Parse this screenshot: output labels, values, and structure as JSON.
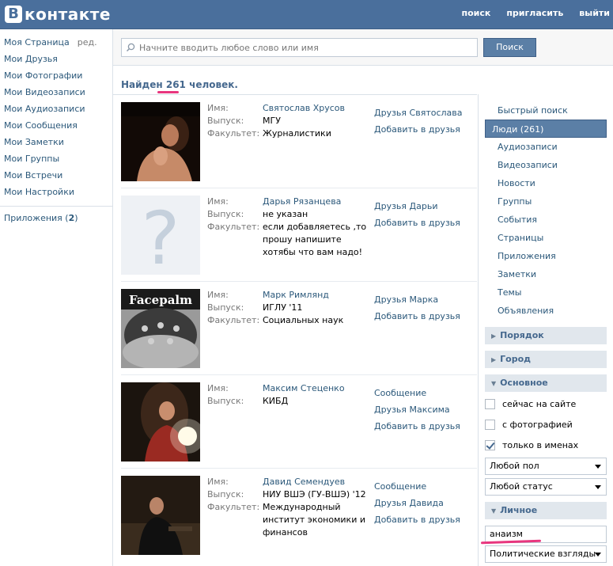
{
  "header": {
    "logo_letter": "В",
    "logo_text": "контакте",
    "nav": [
      "поиск",
      "пригласить",
      "выйти"
    ]
  },
  "left_menu": {
    "items": [
      "Моя Страница",
      "Мои Друзья",
      "Мои Фотографии",
      "Мои Видеозаписи",
      "Мои Аудиозаписи",
      "Мои Сообщения",
      "Мои Заметки",
      "Мои Группы",
      "Мои Встречи",
      "Мои Настройки"
    ],
    "edit": "ред.",
    "apps_label": "Приложения (",
    "apps_count": "2",
    "apps_close": ")"
  },
  "search": {
    "placeholder": "Начните вводить любое слово или имя",
    "button": "Поиск"
  },
  "found": {
    "prefix": "Найден",
    "count": "261",
    "suffix": "человек."
  },
  "field_labels": {
    "name": "Имя:",
    "grad": "Выпуск:",
    "faculty": "Факультет:"
  },
  "results": [
    {
      "name": "Святослав Хрусов",
      "grad": "МГУ",
      "faculty": "Журналистики",
      "actions": [
        "Друзья Святослава",
        "Добавить в друзья"
      ]
    },
    {
      "name": "Дарья Рязанцева",
      "grad": "не указан",
      "faculty": "если добавляетесь ,то прошу напишите хотябы что вам надо!",
      "actions": [
        "Друзья Дарьи",
        "Добавить в друзья"
      ]
    },
    {
      "name": "Марк Римлянд",
      "grad": "ИГЛУ '11",
      "faculty": "Социальных наук",
      "actions": [
        "Друзья Марка",
        "Добавить в друзья"
      ]
    },
    {
      "name": "Максим Стеценко",
      "grad": "КИБД",
      "faculty": "",
      "actions": [
        "Сообщение",
        "Друзья Максима",
        "Добавить в друзья"
      ]
    },
    {
      "name": "Давид Семендуев",
      "grad": "НИУ ВШЭ (ГУ-ВШЭ) '12",
      "faculty": "Международный институт экономики и финансов",
      "actions": [
        "Сообщение",
        "Друзья Давида",
        "Добавить в друзья"
      ]
    }
  ],
  "photo3_text": "Facepalm",
  "right_menu": {
    "items": [
      "Быстрый поиск",
      "Люди (261)",
      "Аудиозаписи",
      "Видеозаписи",
      "Новости",
      "Группы",
      "События",
      "Страницы",
      "Приложения",
      "Заметки",
      "Темы",
      "Объявления"
    ],
    "active_index": 1
  },
  "filters": {
    "order": "Порядок",
    "city": "Город",
    "basic": "Основное",
    "online": "сейчас на сайте",
    "with_photo": "с фотографией",
    "names_only": "только в именах",
    "gender": "Любой пол",
    "status": "Любой статус",
    "personal": "Личное",
    "personal_value": "анаизм",
    "political": "Политические взгляды"
  }
}
